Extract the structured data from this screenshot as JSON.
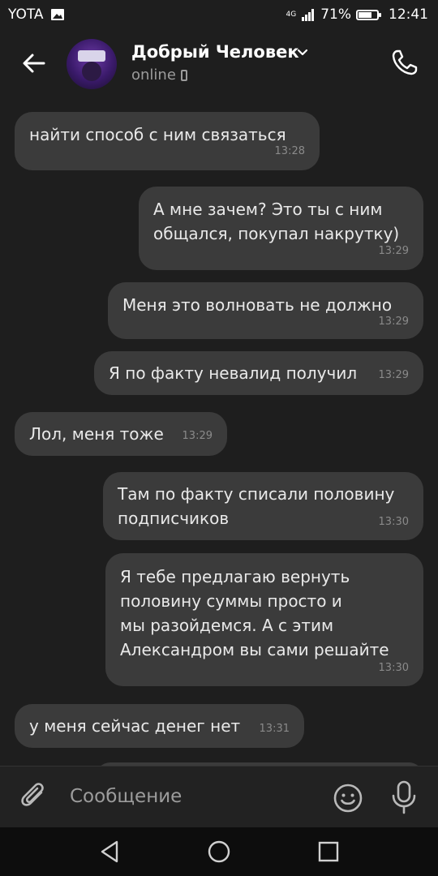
{
  "status_bar": {
    "carrier": "YOTA",
    "network": "4G",
    "battery_text": "71%",
    "battery_level": 0.71,
    "time": "12:41"
  },
  "header": {
    "contact_name": "Добрый Человек",
    "presence": "online",
    "icons": [
      "back-arrow-icon",
      "chevron-down-icon",
      "mobile-icon",
      "phone-call-icon"
    ]
  },
  "messages": [
    {
      "side": "in",
      "text": "найти способ с ним связаться",
      "time": "13:28"
    },
    {
      "side": "out",
      "text": "А мне зачем? Это ты с ним\nобщался, покупал накрутку)",
      "time": "13:29"
    },
    {
      "side": "out",
      "text": "Меня это волновать не должно",
      "time": "13:29"
    },
    {
      "side": "out",
      "text": "Я по факту невалид получил",
      "time": "13:29"
    },
    {
      "side": "in",
      "text": "Лол, меня тоже",
      "time": "13:29"
    },
    {
      "side": "out",
      "text": "Там по факту списали половину\nподписчиков",
      "time": "13:30"
    },
    {
      "side": "out",
      "text": "Я тебе предлагаю вернуть\nполовину суммы просто и\nмы разойдемся. А с этим\nАлександром вы сами решайте",
      "time": "13:30"
    },
    {
      "side": "in",
      "text": "у меня сейчас денег нет",
      "time": "13:31"
    }
  ],
  "composer": {
    "placeholder": "Сообщение",
    "icons": [
      "paperclip-icon",
      "emoji-icon",
      "microphone-icon"
    ]
  },
  "nav": {
    "icons": [
      "back-triangle-icon",
      "home-circle-icon",
      "recents-square-icon"
    ]
  },
  "colors": {
    "background": "#1e1e1e",
    "bubble": "#3b3b3b",
    "text": "#e9e9e9",
    "secondary": "#9b9b9b"
  }
}
